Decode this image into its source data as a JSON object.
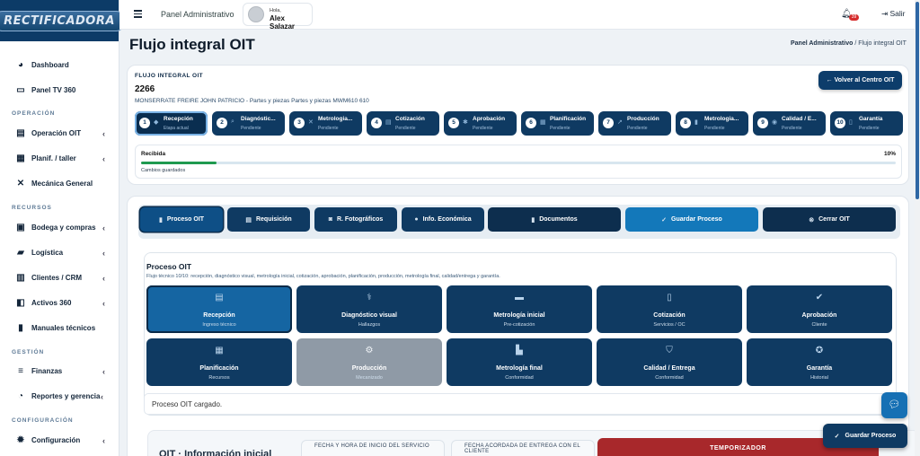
{
  "logo": "RECTIFICADORA",
  "sidebar": {
    "items": [
      {
        "label": "Dashboard",
        "icon": "dashboard-icon",
        "chev": false
      },
      {
        "label": "Panel TV 360",
        "icon": "monitor-icon",
        "chev": false
      },
      {
        "label": "Operación OIT",
        "icon": "clipboard-icon",
        "chev": true
      },
      {
        "label": "Planif. / taller",
        "icon": "calendar-icon",
        "chev": true
      },
      {
        "label": "Mecánica General",
        "icon": "tools-icon",
        "chev": false
      },
      {
        "label": "Bodega y compras",
        "icon": "warehouse-icon",
        "chev": true
      },
      {
        "label": "Logística",
        "icon": "truck-icon",
        "chev": true
      },
      {
        "label": "Clientes / CRM",
        "icon": "building-icon",
        "chev": true
      },
      {
        "label": "Activos 360",
        "icon": "assets-icon",
        "chev": true
      },
      {
        "label": "Manuales técnicos",
        "icon": "book-icon",
        "chev": false
      },
      {
        "label": "Finanzas",
        "icon": "coins-icon",
        "chev": true
      },
      {
        "label": "Reportes y gerencia",
        "icon": "pie-chart-icon",
        "chev": true
      },
      {
        "label": "Configuración",
        "icon": "gear-icon",
        "chev": true
      }
    ],
    "sections": [
      "OPERACIÓN",
      "RECURSOS",
      "GESTIÓN",
      "CONFIGURACIÓN"
    ]
  },
  "topbar": {
    "title": "Panel Administrativo",
    "greeting": "Hola,",
    "user_name": "Alex Salazar",
    "notif_count": "39",
    "logout_label": "Salir"
  },
  "page": {
    "title": "Flujo integral OIT",
    "breadcrumb_root": "Panel Administrativo",
    "breadcrumb_sep": "/",
    "breadcrumb_current": "Flujo integral OIT"
  },
  "flow": {
    "kicker": "FLUJO INTEGRAL OIT",
    "code": "2266",
    "subtitle": "MONSERRATE FREIRE JOHN PATRICIO - Partes y piezas Partes y piezas MWM610 610",
    "back_label": "← Volver al Centro OIT",
    "steps": [
      {
        "num": "1",
        "name": "Recepción",
        "status": "Etapa actual"
      },
      {
        "num": "2",
        "name": "Diagnóstic...",
        "status": "Pendiente"
      },
      {
        "num": "3",
        "name": "Metrologia...",
        "status": "Pendiente"
      },
      {
        "num": "4",
        "name": "Cotización",
        "status": "Pendiente"
      },
      {
        "num": "5",
        "name": "Aprobación",
        "status": "Pendiente"
      },
      {
        "num": "6",
        "name": "Planificación",
        "status": "Pendiente"
      },
      {
        "num": "7",
        "name": "Producción",
        "status": "Pendiente"
      },
      {
        "num": "8",
        "name": "Metrologia...",
        "status": "Pendiente"
      },
      {
        "num": "9",
        "name": "Calidad / E...",
        "status": "Pendiente"
      },
      {
        "num": "10",
        "name": "Garantía",
        "status": "Pendiente"
      }
    ],
    "progress_label": "Recibida",
    "progress_pct_text": "10%",
    "progress_value": 0.1,
    "progress_note": "Cambios guardados"
  },
  "tabs": [
    {
      "label": "Proceso OIT",
      "icon": "file-icon"
    },
    {
      "label": "Requisición",
      "icon": "list-icon"
    },
    {
      "label": "R. Fotográficos",
      "icon": "camera-icon"
    },
    {
      "label": "Info. Económica",
      "icon": "money-icon"
    },
    {
      "label": "Documentos",
      "icon": "document-icon"
    },
    {
      "label": "Guardar Proceso",
      "icon": "check-icon"
    },
    {
      "label": "Cerrar OIT",
      "icon": "close-circle-icon"
    }
  ],
  "process": {
    "title": "Proceso OIT",
    "description": "Flujo técnico 10/10: recepción, diagnóstico visual, metrología inicial, cotización, aprobación, planificación, producción, metrología final, calidad/entrega y garantía.",
    "tiles": [
      {
        "name": "Recepción",
        "sub": "Ingreso técnico",
        "icon": "clipboard-icon"
      },
      {
        "name": "Diagnóstico visual",
        "sub": "Hallazgos",
        "icon": "stethoscope-icon"
      },
      {
        "name": "Metrología inicial",
        "sub": "Pre-cotización",
        "icon": "ruler-icon"
      },
      {
        "name": "Cotización",
        "sub": "Servicios / OC",
        "icon": "invoice-icon"
      },
      {
        "name": "Aprobación",
        "sub": "Cliente",
        "icon": "check-badge-icon"
      },
      {
        "name": "Planificación",
        "sub": "Recursos",
        "icon": "calendar-check-icon"
      },
      {
        "name": "Producción",
        "sub": "Mecanizado",
        "icon": "gears-icon"
      },
      {
        "name": "Metrología final",
        "sub": "Conformidad",
        "icon": "ruler-combined-icon"
      },
      {
        "name": "Calidad / Entrega",
        "sub": "Conformidad",
        "icon": "shield-icon"
      },
      {
        "name": "Garantía",
        "sub": "Historial",
        "icon": "award-icon"
      }
    ],
    "status_text": "Proceso OIT cargado."
  },
  "info": {
    "title": "OIT · Información inicial",
    "field1_label": "FECHA Y HORA DE INICIO DEL SERVICIO",
    "field2_label": "FECHA ACORDADA DE ENTREGA CON EL CLIENTE",
    "timer_label": "TEMPORIZADOR"
  },
  "fab": {
    "save_label": "Guardar Proceso"
  },
  "colors": {
    "primary": "#0f3a62",
    "accent_blue": "#1378ba",
    "success": "#1f9a4f",
    "danger": "#a8282b"
  }
}
